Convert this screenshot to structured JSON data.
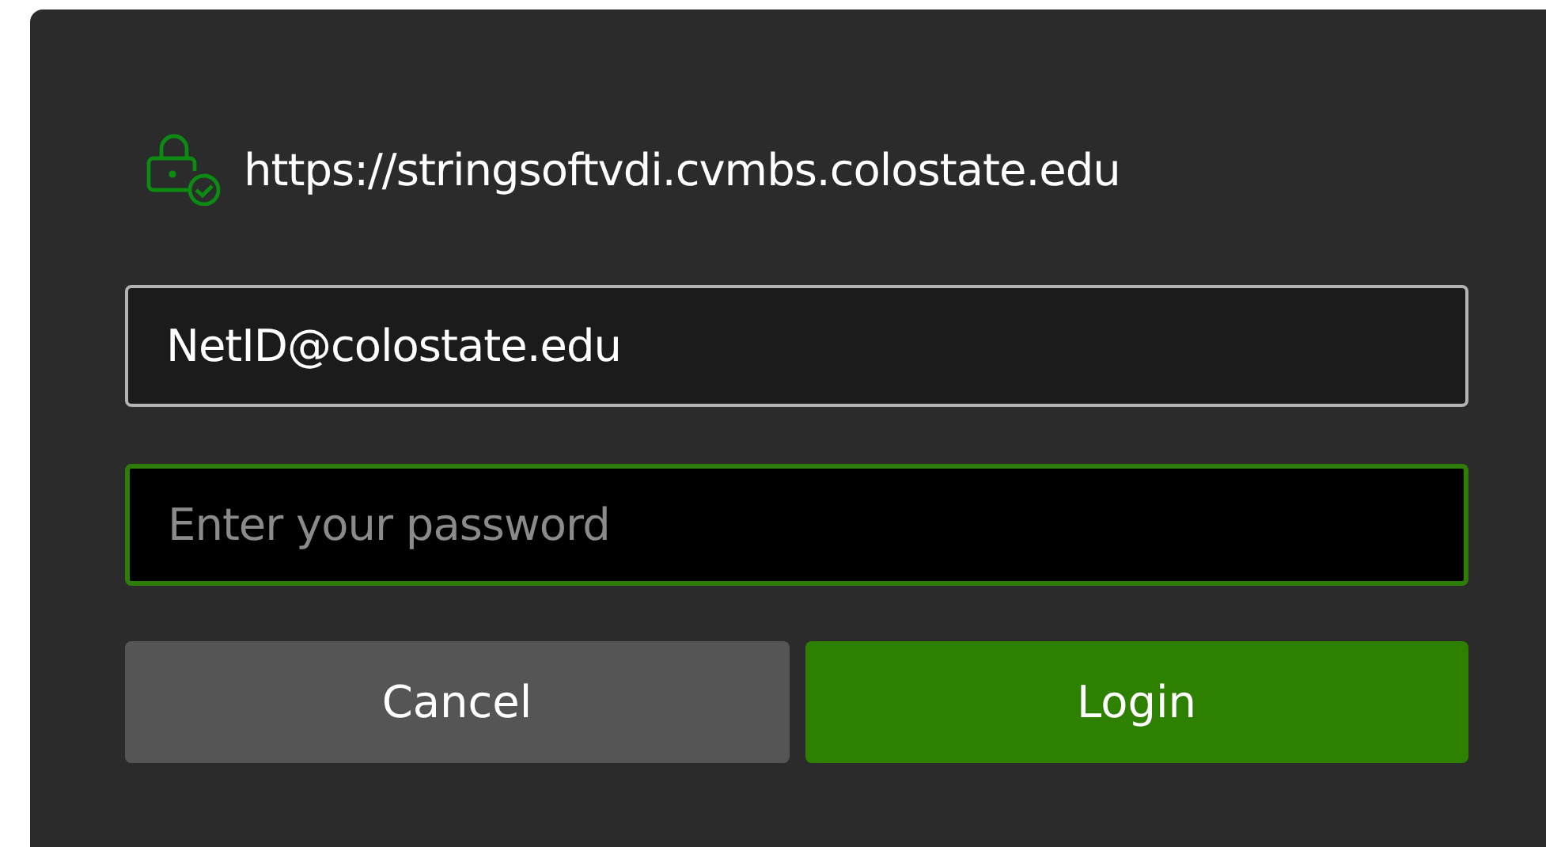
{
  "site": {
    "url": "https://stringsoftvdi.cvmbs.colostate.edu"
  },
  "fields": [
    {
      "kind": "text",
      "value": "NetID@colostate.edu",
      "focused": false
    },
    {
      "kind": "password",
      "placeholder": "Enter your password",
      "focused": true
    }
  ],
  "buttons": [
    {
      "label": "Cancel",
      "primary": false
    },
    {
      "label": "Login",
      "primary": true
    }
  ]
}
